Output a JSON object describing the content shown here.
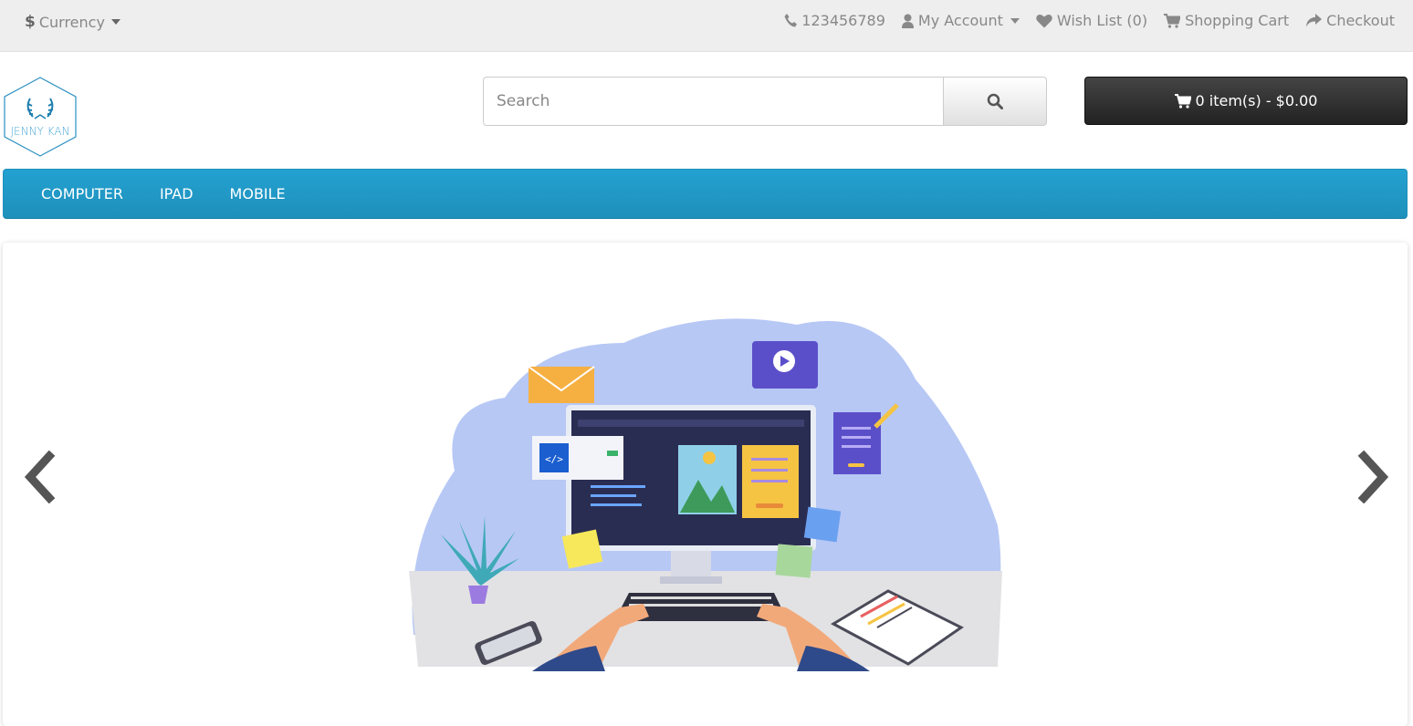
{
  "topbar": {
    "currency_symbol": "$",
    "currency_label": "Currency",
    "phone": "123456789",
    "my_account": "My Account",
    "wish_list": "Wish List (0)",
    "shopping_cart": "Shopping Cart",
    "checkout": "Checkout"
  },
  "header": {
    "logo_text": "JENNY KAN",
    "search_placeholder": "Search",
    "cart_label": "0 item(s) - $0.00"
  },
  "nav": {
    "items": [
      "COMPUTER",
      "IPAD",
      "MOBILE"
    ]
  },
  "icons": {
    "phone": "phone-icon",
    "account": "user-icon",
    "wishlist": "heart-icon",
    "cart": "cart-icon",
    "checkout": "share-icon",
    "search": "search-icon",
    "prev": "chevron-left-icon",
    "next": "chevron-right-icon"
  },
  "colors": {
    "brand_blue": "#229ac8",
    "topbar_bg": "#eeeeee",
    "cart_button": "#303030"
  }
}
